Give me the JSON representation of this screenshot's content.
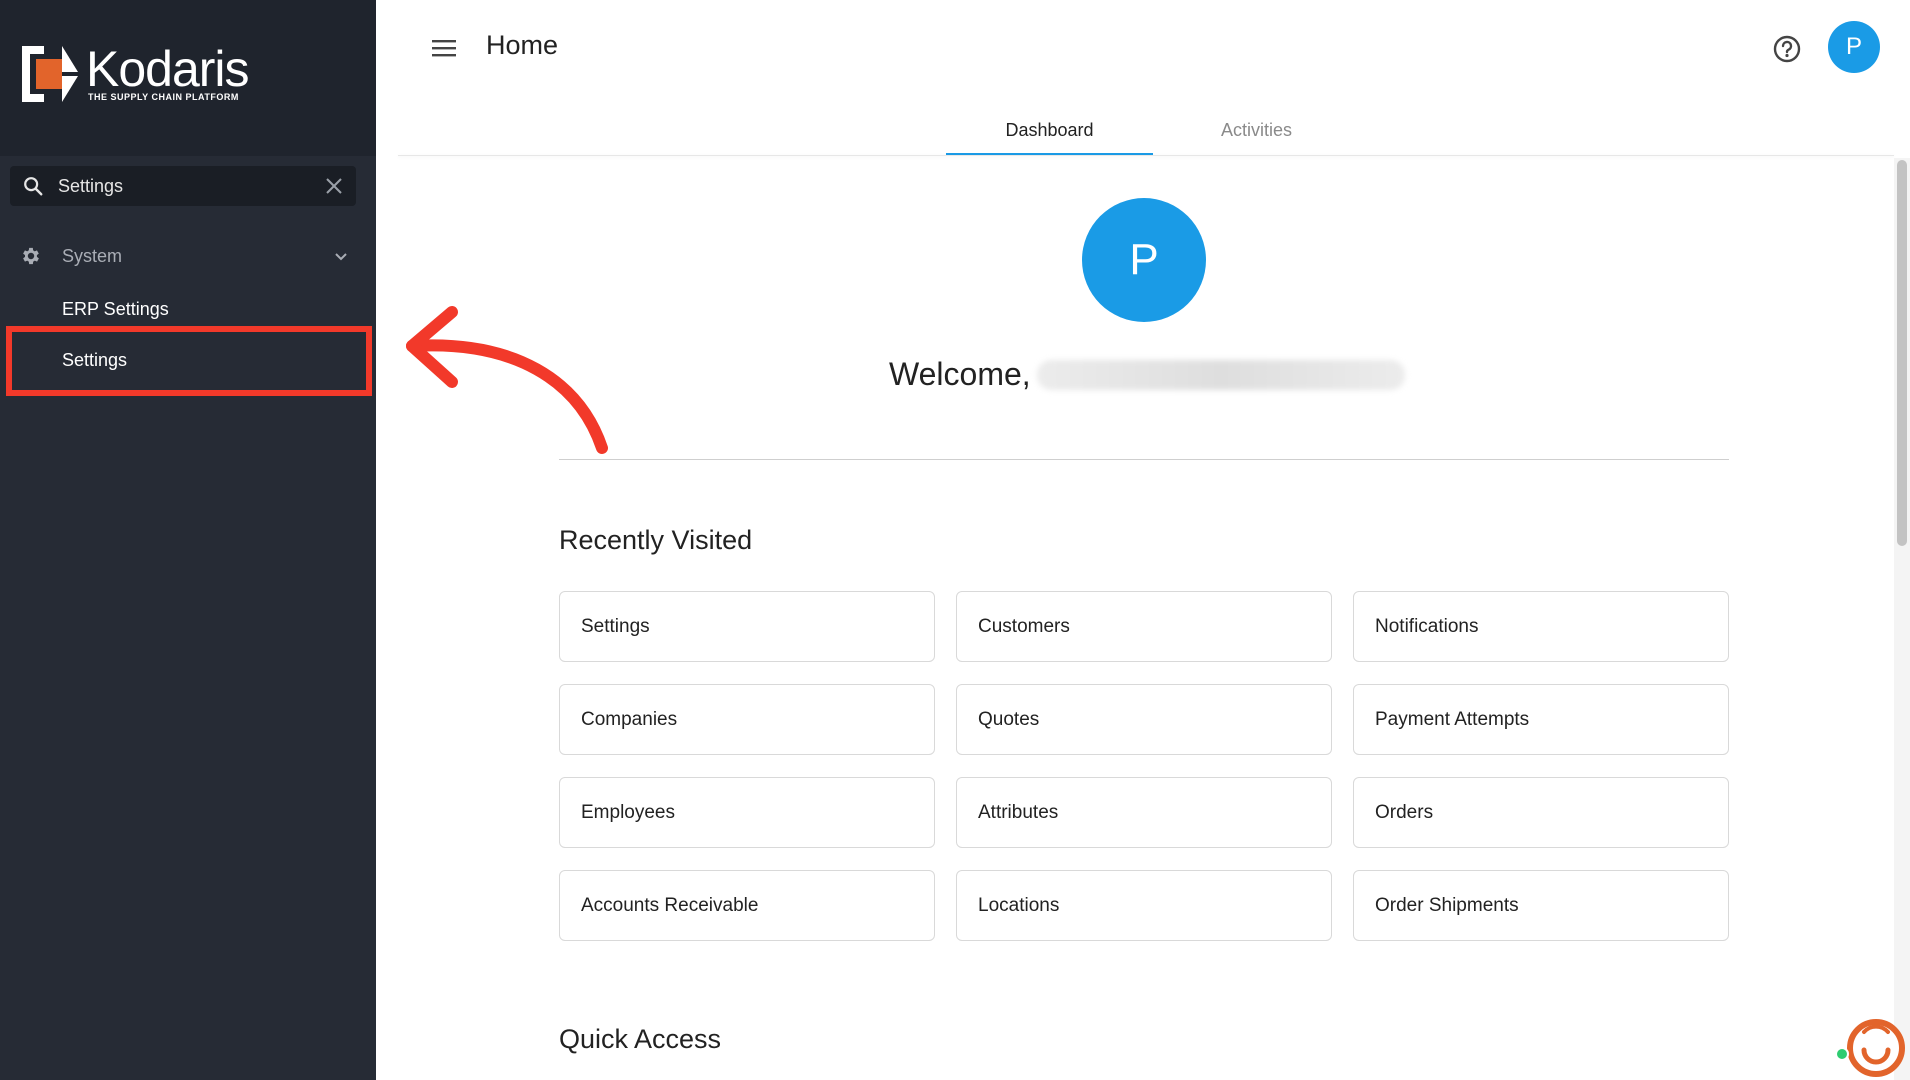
{
  "brand": {
    "name": "Kodaris",
    "tagline": "THE SUPPLY CHAIN PLATFORM",
    "accent_color": "#e2642b"
  },
  "sidebar": {
    "search": {
      "value": "Settings",
      "placeholder": ""
    },
    "group": {
      "label": "System",
      "icon": "gear-icon",
      "expanded": true
    },
    "items": [
      {
        "label": "ERP Settings"
      },
      {
        "label": "Settings",
        "highlighted": true
      }
    ],
    "bg_color": "#262b35"
  },
  "header": {
    "title": "Home",
    "avatar_initial": "P"
  },
  "tabs": [
    {
      "label": "Dashboard",
      "active": true
    },
    {
      "label": "Activities",
      "active": false
    }
  ],
  "main": {
    "avatar_initial": "P",
    "welcome_prefix": "Welcome,",
    "recent_title": "Recently Visited",
    "recent_items": [
      "Settings",
      "Customers",
      "Notifications",
      "Companies",
      "Quotes",
      "Payment Attempts",
      "Employees",
      "Attributes",
      "Orders",
      "Accounts Receivable",
      "Locations",
      "Order Shipments"
    ],
    "quick_title": "Quick Access"
  },
  "colors": {
    "primary": "#1a9be6",
    "highlight": "#f2392a"
  }
}
